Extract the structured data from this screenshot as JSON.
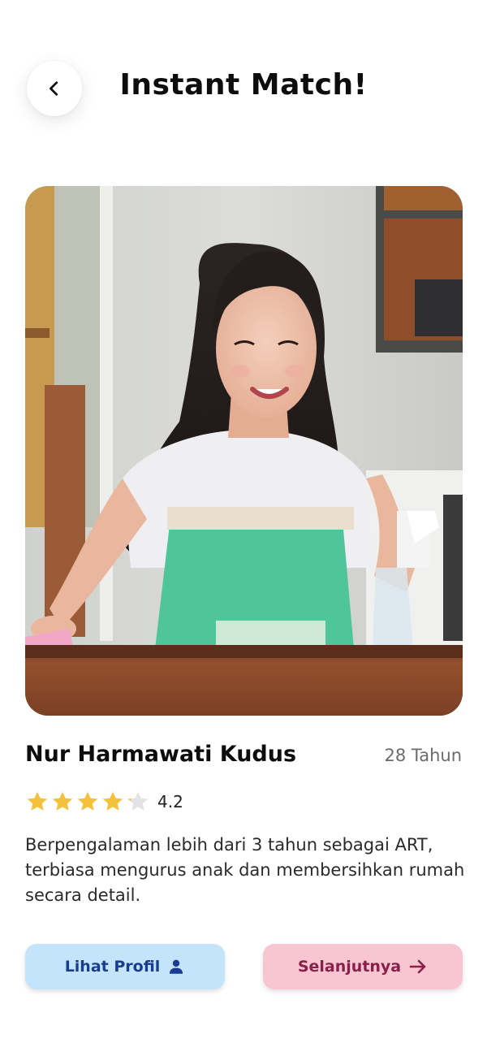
{
  "header": {
    "title": "Instant Match!",
    "back_icon": "chevron-left-icon"
  },
  "profile": {
    "photo": "woman-cleaning-table-photo",
    "name": "Nur Harmawati Kudus",
    "age": "28 Tahun",
    "rating": 4.2,
    "rating_label": "4.2",
    "max_stars": 5,
    "description": "Berpengalaman lebih dari 3 tahun sebagai ART, terbiasa mengurus anak dan membersihkan rumah secara detail."
  },
  "actions": {
    "profile_label": "Lihat Profil",
    "profile_icon": "person-icon",
    "next_label": "Selanjutnya",
    "next_icon": "arrow-right-icon"
  },
  "colors": {
    "star_filled": "#F4C23A",
    "star_empty": "#E3E3E6",
    "profile_button_bg": "#C3E4FB",
    "profile_button_text": "#1B3D8F",
    "next_button_bg": "#F7C6D1",
    "next_button_text": "#8A1F4B"
  }
}
